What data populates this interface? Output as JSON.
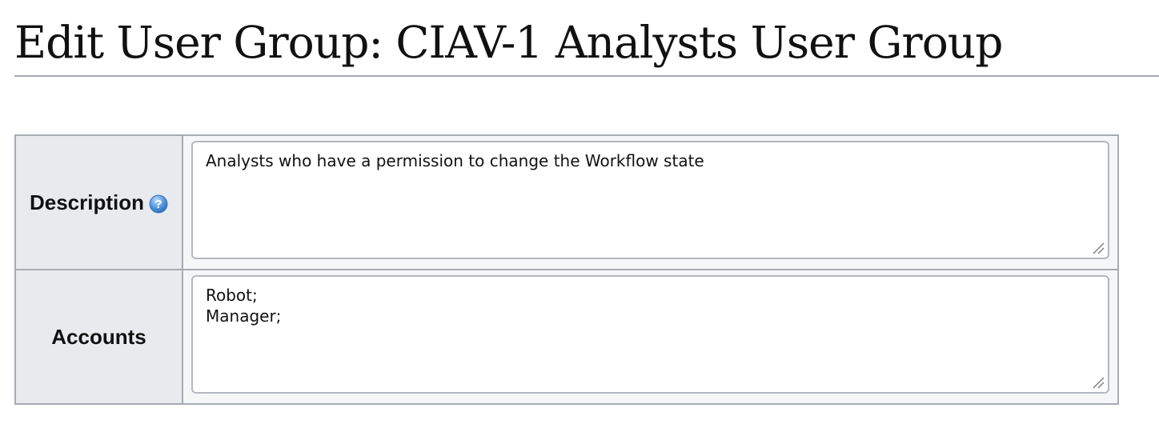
{
  "page": {
    "title": "Edit User Group: CIAV-1 Analysts User Group"
  },
  "form": {
    "description": {
      "label": "Description",
      "help_icon": "help-icon",
      "value": "Analysts who have a permission to change the Workflow state"
    },
    "accounts": {
      "label": "Accounts",
      "value": "Robot;\nManager;"
    }
  },
  "colors": {
    "label_background": "#e9eaee",
    "border": "#a7abb3",
    "help_icon_blue": "#4a90d9"
  }
}
